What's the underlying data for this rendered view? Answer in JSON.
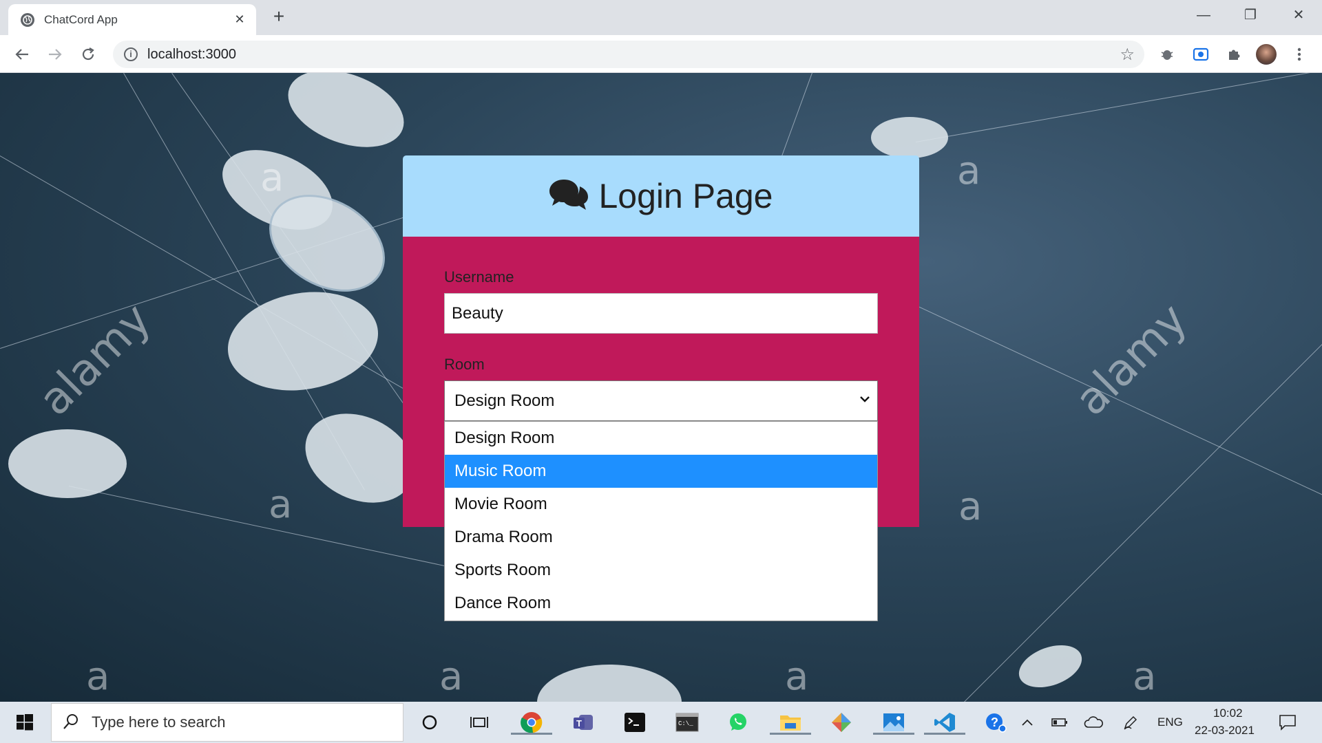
{
  "browser": {
    "tab_title": "ChatCord App",
    "tab_close": "✕",
    "new_tab": "+",
    "url": "localhost:3000",
    "win_minimize": "—",
    "win_restore": "❐",
    "win_close": "✕"
  },
  "watermark": {
    "brand": "alamy",
    "mark": "a"
  },
  "login": {
    "title": "Login Page",
    "username_label": "Username",
    "username_value": "Beauty",
    "room_label": "Room",
    "room_selected": "Design Room",
    "room_options": [
      "Design Room",
      "Music Room",
      "Movie Room",
      "Drama Room",
      "Sports Room",
      "Dance Room"
    ],
    "highlighted_option": "Music Room"
  },
  "taskbar": {
    "search_placeholder": "Type here to search",
    "language": "ENG",
    "time": "10:02",
    "date": "22-03-2021"
  },
  "colors": {
    "header_bg": "#a8dcfd",
    "body_bg": "#c0195a",
    "highlight": "#1e90ff"
  }
}
